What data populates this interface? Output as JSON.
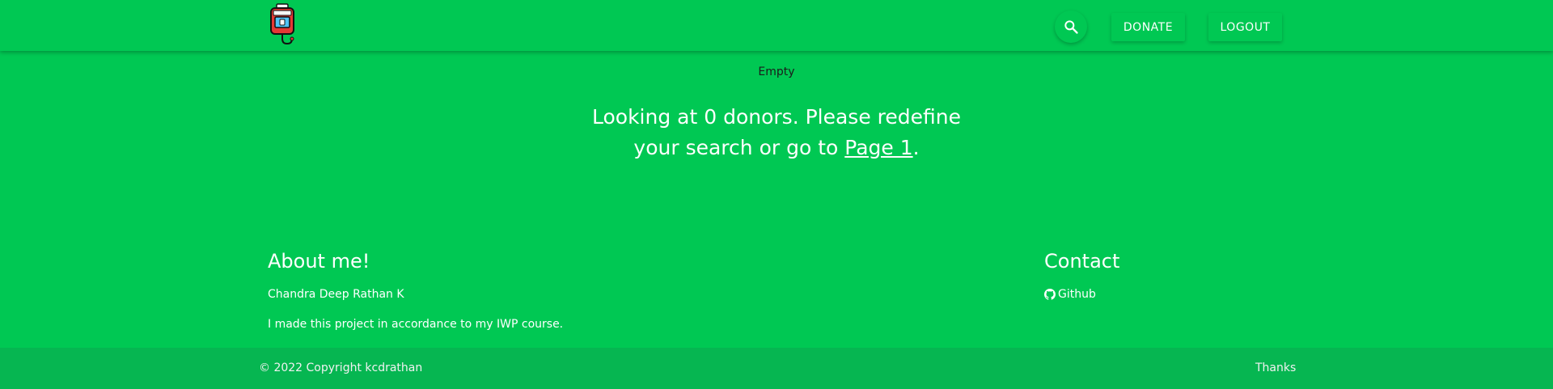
{
  "header": {
    "logo_icon": "blood-bag-icon",
    "search_icon": "search-icon",
    "donate_label": "DONATE",
    "logout_label": "LOGOUT"
  },
  "main": {
    "empty_label": "Empty",
    "message_before": "Looking at 0 donors. Please redefine your search or go to ",
    "page_link": "Page 1",
    "message_after": "."
  },
  "footer": {
    "about_title": "About me!",
    "about_name": "Chandra Deep Rathan K",
    "about_desc": "I made this project in accordance to my IWP course.",
    "contact_title": "Contact",
    "github_icon": "github-icon",
    "github_label": "Github",
    "copyright": "© 2022 Copyright kcdrathan",
    "thanks": "Thanks"
  },
  "colors": {
    "primary": "#00c853",
    "footer_bar": "#06b651",
    "logo_red": "#e53935"
  }
}
